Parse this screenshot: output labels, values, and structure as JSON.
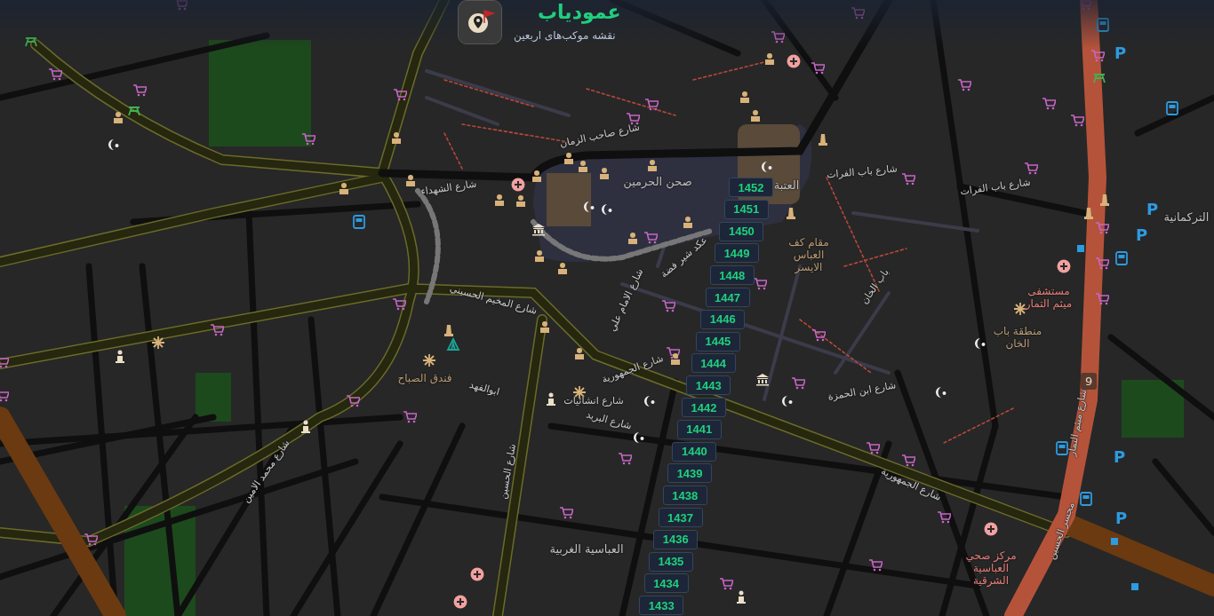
{
  "header": {
    "title": "عمودياب",
    "subtitle": "نقشه موکب‌های اربعین"
  },
  "labels": [
    {
      "text": "شارع الشهداء",
      "kind": "street"
    },
    {
      "text": "العتبة",
      "kind": "place"
    },
    {
      "text": "صحن الحرمين",
      "kind": "place"
    },
    {
      "text": "شارع صاحب الزمان",
      "kind": "street"
    },
    {
      "text": "مقام كف العباس الايسر",
      "kind": "landmark"
    },
    {
      "text": "شارع باب الفرات",
      "kind": "street"
    },
    {
      "text": "شارع باب الفرات",
      "kind": "street"
    },
    {
      "text": "التركمانية",
      "kind": "place"
    },
    {
      "text": "مستشفى ميثم التمار",
      "kind": "clinic"
    },
    {
      "text": "منطقة باب الخان",
      "kind": "landmark"
    },
    {
      "text": "باب الخان",
      "kind": "street"
    },
    {
      "text": "شارع الامام علي",
      "kind": "street"
    },
    {
      "text": "عكد شير فضة",
      "kind": "street"
    },
    {
      "text": "شارع المخيم الحسيني",
      "kind": "street"
    },
    {
      "text": "فندق الصباح",
      "kind": "landmark"
    },
    {
      "text": "ابوالفهد",
      "kind": "street"
    },
    {
      "text": "شارع انشائيات",
      "kind": "street"
    },
    {
      "text": "شارع البريد",
      "kind": "street"
    },
    {
      "text": "شارع الجمهورية",
      "kind": "street"
    },
    {
      "text": "شارع الجمهورية",
      "kind": "street"
    },
    {
      "text": "شارع ابن الحمزة",
      "kind": "street"
    },
    {
      "text": "شارع محمد الامين",
      "kind": "street"
    },
    {
      "text": "شارع الحسين",
      "kind": "street"
    },
    {
      "text": "العباسية الغربية",
      "kind": "place"
    },
    {
      "text": "مركز صحي العباسية الشرقية",
      "kind": "clinic"
    },
    {
      "text": "شارع ميثم التمار",
      "kind": "street"
    },
    {
      "text": "مجسر الحسين",
      "kind": "street"
    }
  ],
  "route_shield": "9",
  "parking_signs": [
    "P",
    "P",
    "P",
    "P",
    "P"
  ],
  "mawkib_markers": [
    {
      "number": "1452"
    },
    {
      "number": "1451"
    },
    {
      "number": "1450"
    },
    {
      "number": "1449"
    },
    {
      "number": "1448"
    },
    {
      "number": "1447"
    },
    {
      "number": "1446"
    },
    {
      "number": "1445"
    },
    {
      "number": "1444"
    },
    {
      "number": "1443"
    },
    {
      "number": "1442"
    },
    {
      "number": "1441"
    },
    {
      "number": "1440"
    },
    {
      "number": "1439"
    },
    {
      "number": "1438"
    },
    {
      "number": "1437"
    },
    {
      "number": "1436"
    },
    {
      "number": "1435"
    },
    {
      "number": "1434"
    },
    {
      "number": "1433"
    }
  ]
}
